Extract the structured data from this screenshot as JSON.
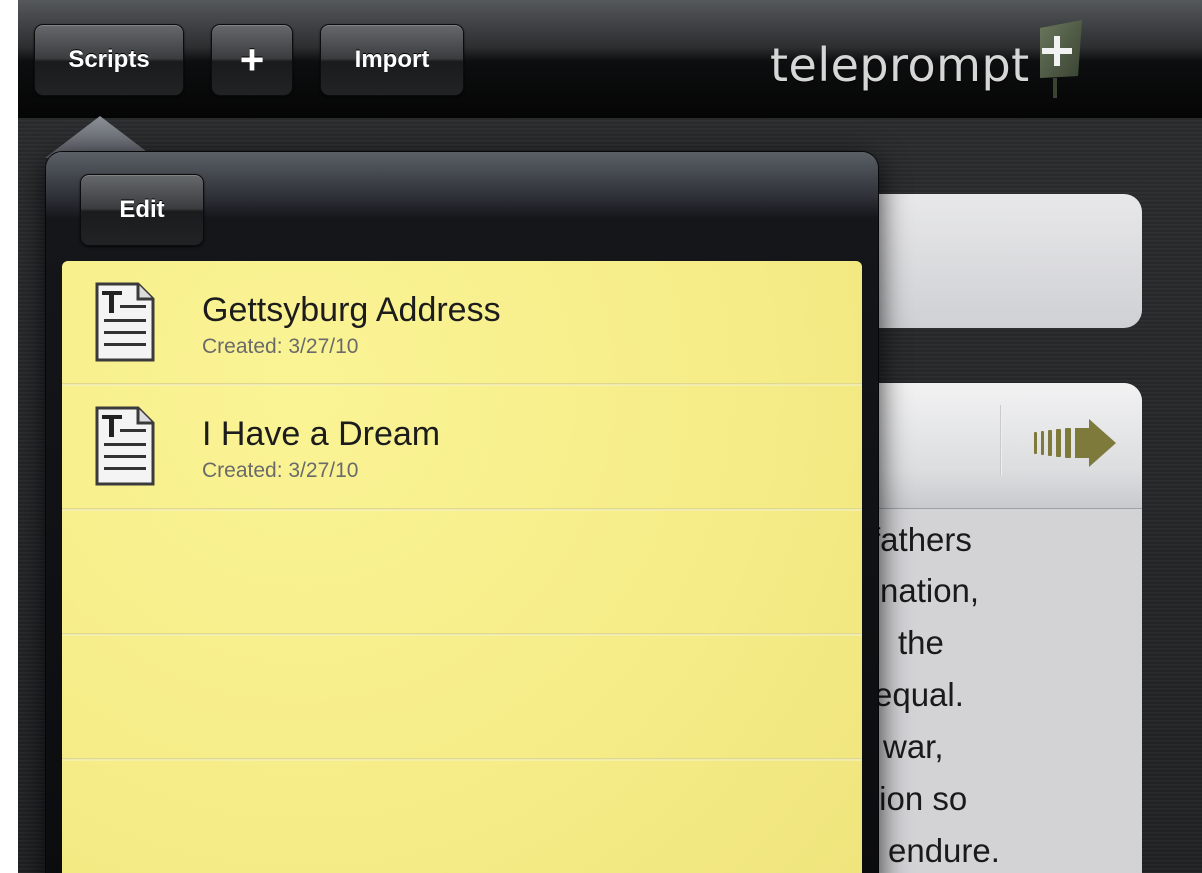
{
  "app": {
    "logo_text": "teleprompt",
    "logo_mark": "plus-flag-logo"
  },
  "toolbar": {
    "scripts_label": "Scripts",
    "add_label": "+",
    "import_label": "Import"
  },
  "popover": {
    "edit_label": "Edit",
    "scripts": [
      {
        "title": "Gettsyburg Address",
        "created": "Created: 3/27/10",
        "icon": "text-document-icon"
      },
      {
        "title": "I Have a Dream",
        "created": "Created: 3/27/10",
        "icon": "text-document-icon"
      }
    ]
  },
  "prompter": {
    "play_icon": "forward-arrow-icon",
    "visible_text_lines": [
      "fathers",
      "nation,",
      "the",
      "equal.",
      "war,",
      "tion so",
      "endure."
    ]
  },
  "colors": {
    "notepad_yellow": "#f5ec87",
    "toolbar_dark": "#0d0e0f",
    "arrow_olive": "#7d7a3c"
  }
}
